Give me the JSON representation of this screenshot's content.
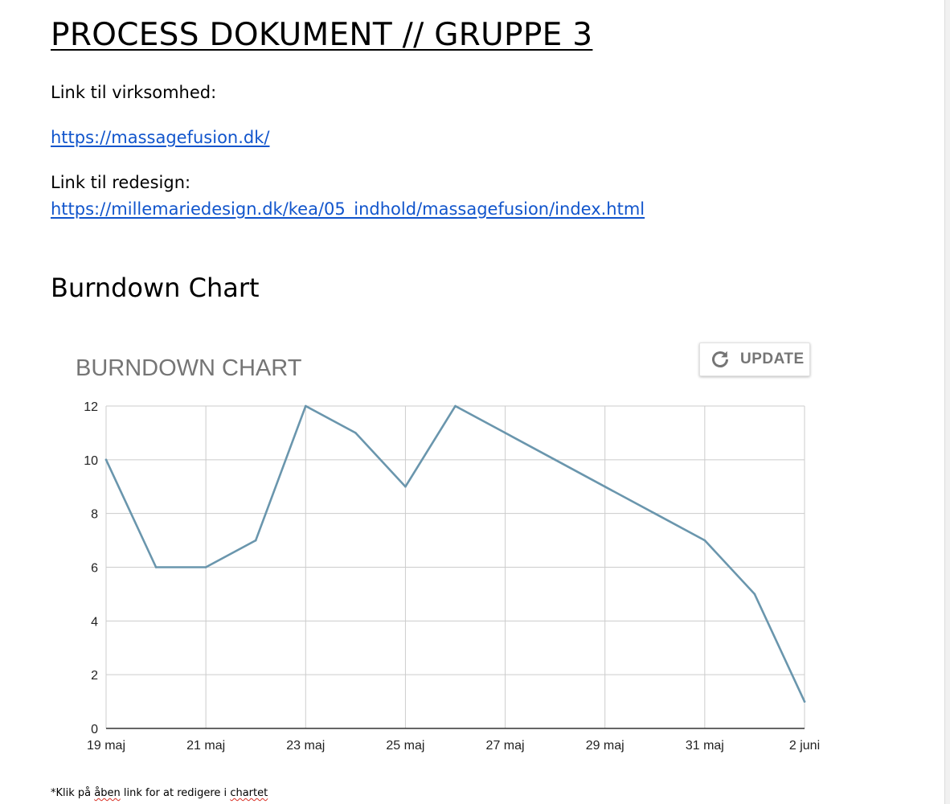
{
  "document": {
    "title": "PROCESS DOKUMENT // GRUPPE 3",
    "company_label": "Link til virksomhed:",
    "company_link": "https://massagefusion.dk/",
    "redesign_label": "Link til redesign:",
    "redesign_link": "https://millemariedesign.dk/kea/05_indhold/massagefusion/index.html",
    "section_heading": "Burndown Chart",
    "footnote": {
      "part1": "*Klik på ",
      "part2": "åben",
      "part3": " link for at redigere i ",
      "part4": "chartet"
    }
  },
  "chart_widget": {
    "update_label": "UPDATE",
    "update_icon": "refresh-icon"
  },
  "colors": {
    "link": "#1155cc",
    "series_line": "#6a96ad",
    "gridline": "#cccccc",
    "chart_title": "#757575"
  },
  "chart_data": {
    "type": "line",
    "title": "BURNDOWN CHART",
    "xlabel": "",
    "ylabel": "",
    "x": [
      "19 maj",
      "20 maj",
      "21 maj",
      "22 maj",
      "23 maj",
      "24 maj",
      "25 maj",
      "26 maj",
      "27 maj",
      "28 maj",
      "29 maj",
      "30 maj",
      "31 maj",
      "1 juni",
      "2 juni"
    ],
    "x_tick_labels": [
      "19 maj",
      "21 maj",
      "23 maj",
      "25 maj",
      "27 maj",
      "29 maj",
      "31 maj",
      "2 juni"
    ],
    "series": [
      {
        "values": [
          10,
          6,
          6,
          7,
          12,
          11,
          9,
          12,
          11,
          10,
          9,
          8,
          7,
          5,
          1
        ]
      }
    ],
    "ylim": [
      0,
      12
    ],
    "y_ticks": [
      0,
      2,
      4,
      6,
      8,
      10,
      12
    ],
    "grid": true,
    "legend": "none"
  }
}
